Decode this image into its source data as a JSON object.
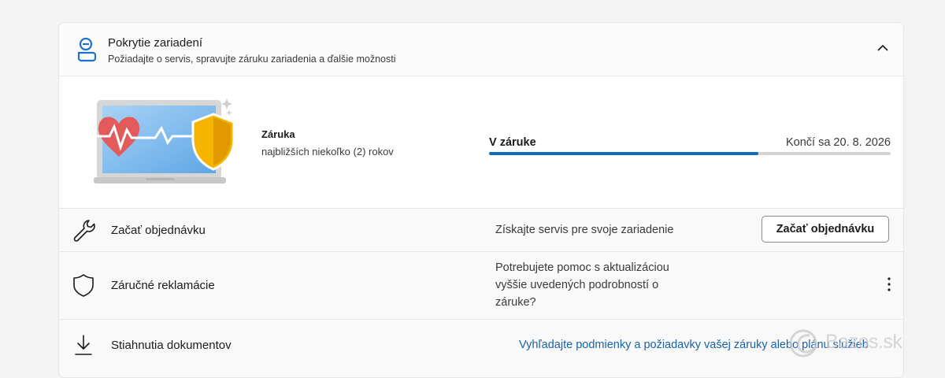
{
  "section": {
    "title": "Pokrytie zariadení",
    "subtitle": "Požiadajte o servis, spravujte záruku zariadenia a ďalšie možnosti",
    "icon": "device-support-icon",
    "collapse_icon": "chevron-up-icon"
  },
  "warranty": {
    "title": "Záruka",
    "subtitle": "najbližších niekoľko (2) rokov",
    "status_label": "V záruke",
    "end_date_text": "Končí sa 20. 8. 2026",
    "progress": 0.67,
    "accent_color": "#0f6cbd"
  },
  "rows": [
    {
      "icon": "wrench-icon",
      "label": "Začať objednávku",
      "description": "Získajte servis pre svoje zariadenie",
      "button_label": "Začať objednávku"
    },
    {
      "icon": "shield-icon",
      "label": "Záručné reklamácie",
      "description_lines": [
        "Potrebujete pomoc s aktualizáciou",
        "vyššie uvedených podrobností o",
        "záruke?"
      ],
      "menu_icon": "more-vertical-icon"
    },
    {
      "icon": "download-icon",
      "label": "Stiahnutia dokumentov",
      "link_text": "Vyhľadajte podmienky a požiadavky vašej záruky alebo plánu služieb",
      "link_color": "#1862a8"
    }
  ],
  "watermark": {
    "text": "Bazos.sk"
  }
}
